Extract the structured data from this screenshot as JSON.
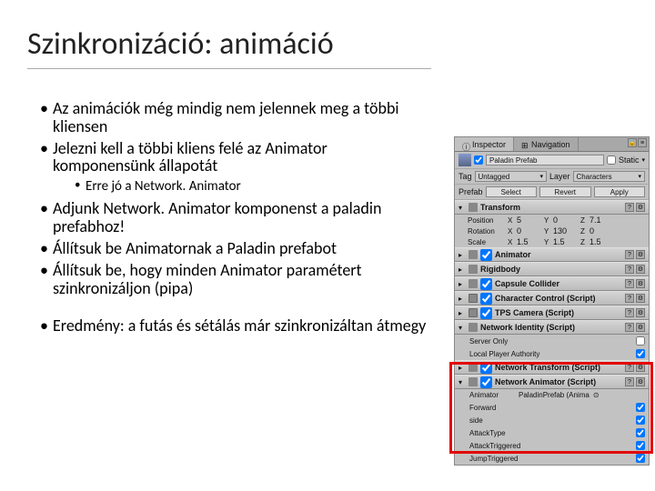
{
  "title": "Szinkronizáció: animáció",
  "bullets": {
    "b1": "Az animációk még mindig nem jelennek meg a többi kliensen",
    "b2": "Jelezni kell a többi kliens felé az Animator komponensünk állapotát",
    "b2a": "Erre jó a Network. Animator",
    "b3": "Adjunk Network. Animator komponenst a paladin prefabhoz!",
    "b4": "Állítsuk be Animatornak a Paladin prefabot",
    "b5": "Állítsuk be, hogy minden Animator paramétert szinkronizáljon (pipa)",
    "b6": "Eredmény: a futás és sétálás már szinkronizáltan átmegy"
  },
  "inspector": {
    "tabs": {
      "a": "Inspector",
      "b": "Navigation"
    },
    "static_label": "Static",
    "obj_name": "Paladin Prefab",
    "tag_label": "Tag",
    "tag_value": "Untagged",
    "layer_label": "Layer",
    "layer_value": "Characters",
    "prefab_label": "Prefab",
    "select": "Select",
    "revert": "Revert",
    "apply": "Apply",
    "transform": "Transform",
    "pos": "Position",
    "rot": "Rotation",
    "scale": "Scale",
    "px": "5",
    "py": "0",
    "pz": "7.1",
    "rx": "0",
    "ry": "130",
    "rz": "0",
    "sx": "1.5",
    "sy": "1.5",
    "sz": "1.5",
    "comp_anim": "Animator",
    "comp_rigid": "Rigidbody",
    "comp_capsule": "Capsule Collider",
    "comp_char": "Character Control (Script)",
    "comp_tps": "TPS Camera (Script)",
    "comp_neti": "Network Identity (Script)",
    "server_only": "Server Only",
    "local_auth": "Local Player Authority",
    "comp_netanim": "Network Animator (Script)",
    "anim_label": "Animator",
    "anim_value": "PaladinPrefab (Anima",
    "p_forward": "Forward",
    "p_side": "side",
    "p_attacktype": "AttackType",
    "p_attackt": "AttackTriggered",
    "p_jumpt": "JumpTriggered",
    "comp_nett": "Network Transform (Script)"
  }
}
